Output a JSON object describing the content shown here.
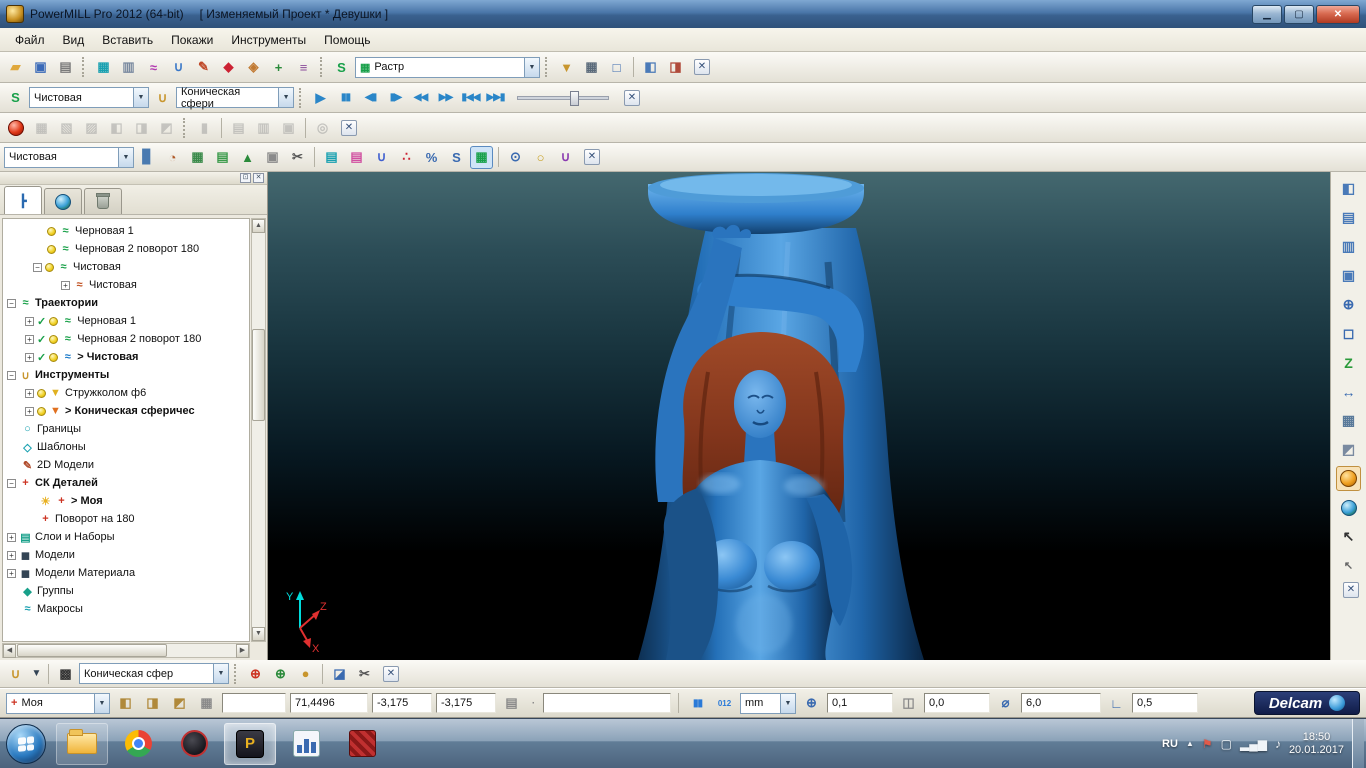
{
  "window": {
    "title": "PowerMILL Pro 2012 (64-bit)",
    "project": "[ Изменяемый Проект * Девушки ]"
  },
  "menubar": {
    "items": [
      "Файл",
      "Вид",
      "Вставить",
      "Покажи",
      "Инструменты",
      "Помощь"
    ]
  },
  "toolbar_main": {
    "ncprogram_combo": "Растр"
  },
  "toolbar_simulation": {
    "toolpath_combo": "Чистовая",
    "tool_combo": "Коническая сфери"
  },
  "toolbar_toolpath": {
    "combo": "Чистовая"
  },
  "toolbar_tool": {
    "combo": "Коническая сфер"
  },
  "explorer": {
    "items": [
      "Черновая 1",
      "Черновая 2 поворот 180",
      "Чистовая",
      "Чистовая",
      "Траектории",
      "Черновая 1",
      "Черновая 2 поворот 180",
      "> Чистовая",
      "Инструменты",
      "Стружколом ф6",
      "> Коническая сферичес",
      "Границы",
      "Шаблоны",
      "2D Модели",
      "СК Деталей",
      "> Моя",
      "Поворот на 180",
      "Слои и Наборы",
      "Модели",
      "Модели Материала",
      "Группы",
      "Макросы"
    ]
  },
  "viewport": {
    "axis_y": "Y",
    "axis_z": "Z",
    "axis_x": "X"
  },
  "statusbar": {
    "workplane_combo": "Моя",
    "coord_x": "71,4496",
    "coord_y": "-3,175",
    "coord_z": "-3,175",
    "ruler_digits": "012",
    "units_combo": "mm",
    "tolerance": "0,1",
    "thickness": "0,0",
    "tool_diameter": "6,0",
    "tip_radius": "0,5",
    "brand": "Delcam"
  },
  "taskbar": {
    "language": "RU",
    "time": "18:50",
    "date": "20.01.2017"
  }
}
